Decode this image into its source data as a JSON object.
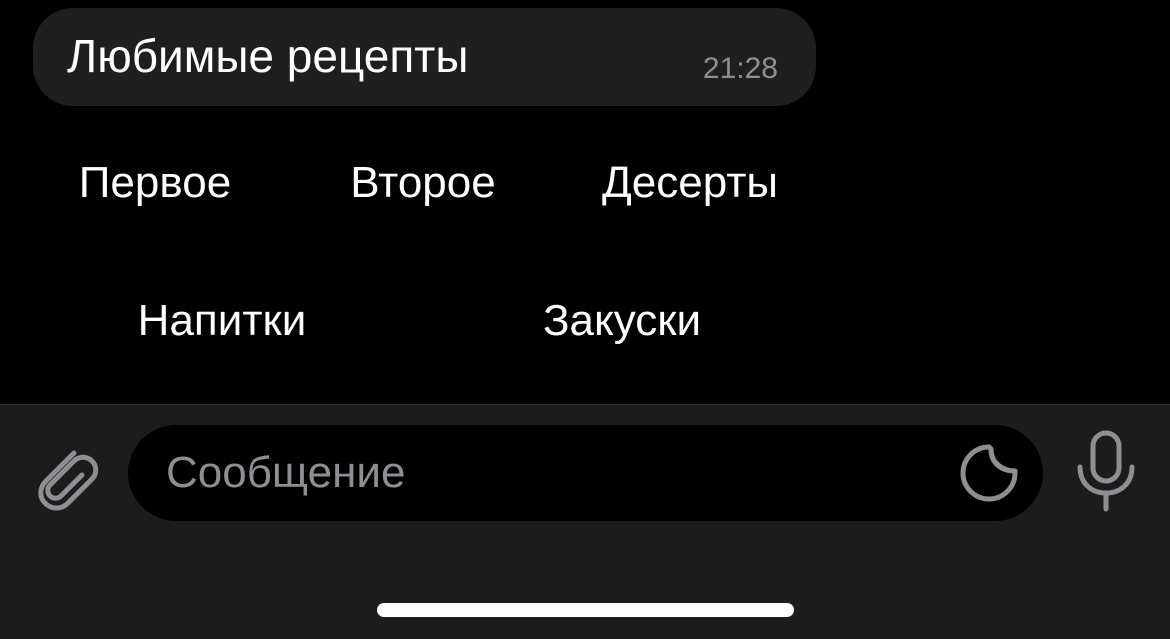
{
  "message": {
    "text": "Любимые рецепты",
    "time": "21:28"
  },
  "keyboard": {
    "rows": [
      [
        "Первое",
        "Второе",
        "Десерты"
      ],
      [
        "Напитки",
        "Закуски"
      ]
    ]
  },
  "input_bar": {
    "placeholder": "Сообщение",
    "value": "",
    "attach_icon": "paperclip-icon",
    "sticker_icon": "sticker-icon",
    "mic_icon": "microphone-icon"
  },
  "colors": {
    "background": "#000000",
    "bubble": "#1f1f1f",
    "input_bar": "#1c1c1d",
    "secondary_text": "#8e8e93",
    "icon": "#8e8e93"
  }
}
